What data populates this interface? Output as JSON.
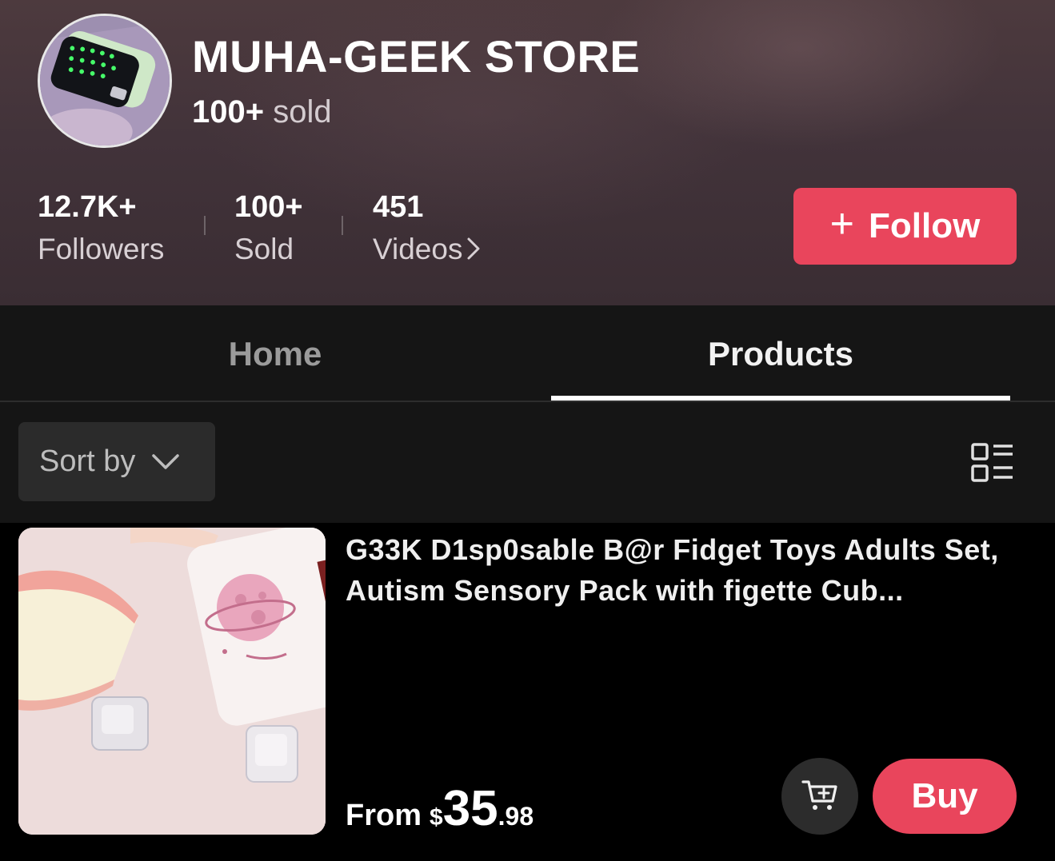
{
  "store": {
    "name": "MUHA-GEEK STORE",
    "sold_count": "100+",
    "sold_label": "sold"
  },
  "stats": [
    {
      "value": "12.7K+",
      "label": "Followers"
    },
    {
      "value": "100+",
      "label": "Sold"
    },
    {
      "value": "451",
      "label": "Videos"
    }
  ],
  "follow_button": {
    "icon": "+",
    "label": "Follow"
  },
  "tabs": [
    {
      "label": "Home",
      "active": false
    },
    {
      "label": "Products",
      "active": true
    }
  ],
  "filter": {
    "sort_label": "Sort by",
    "layout_icon": "list-layout-icon"
  },
  "product": {
    "title": "G33K D1sp0sable B@r Fidget Toys Adults Set, Autism Sensory Pack with figette Cub...",
    "price_prefix": "From",
    "currency": "$",
    "price_main": "35",
    "price_cents": ".98",
    "buy_label": "Buy",
    "cart_icon": "add-to-cart-icon"
  },
  "colors": {
    "accent": "#e9455c",
    "header_bg": "#45353a",
    "tab_bg": "#151515",
    "page_bg": "#000000"
  }
}
